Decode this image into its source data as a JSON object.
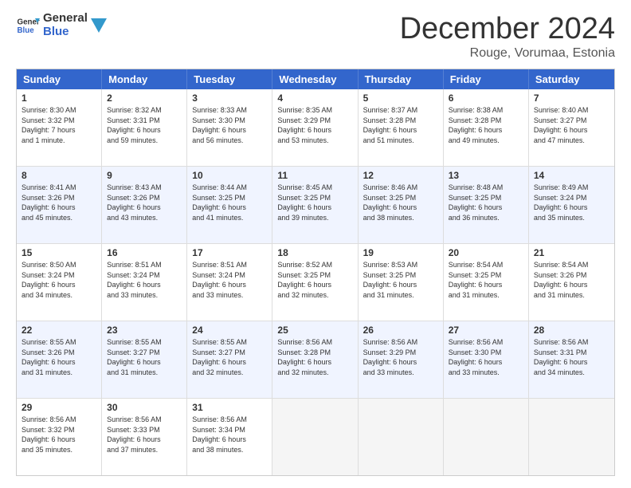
{
  "logo": {
    "line1": "General",
    "line2": "Blue"
  },
  "title": "December 2024",
  "location": "Rouge, Vorumaa, Estonia",
  "days": [
    "Sunday",
    "Monday",
    "Tuesday",
    "Wednesday",
    "Thursday",
    "Friday",
    "Saturday"
  ],
  "weeks": [
    [
      {
        "num": "1",
        "info": "Sunrise: 8:30 AM\nSunset: 3:32 PM\nDaylight: 7 hours\nand 1 minute."
      },
      {
        "num": "2",
        "info": "Sunrise: 8:32 AM\nSunset: 3:31 PM\nDaylight: 6 hours\nand 59 minutes."
      },
      {
        "num": "3",
        "info": "Sunrise: 8:33 AM\nSunset: 3:30 PM\nDaylight: 6 hours\nand 56 minutes."
      },
      {
        "num": "4",
        "info": "Sunrise: 8:35 AM\nSunset: 3:29 PM\nDaylight: 6 hours\nand 53 minutes."
      },
      {
        "num": "5",
        "info": "Sunrise: 8:37 AM\nSunset: 3:28 PM\nDaylight: 6 hours\nand 51 minutes."
      },
      {
        "num": "6",
        "info": "Sunrise: 8:38 AM\nSunset: 3:28 PM\nDaylight: 6 hours\nand 49 minutes."
      },
      {
        "num": "7",
        "info": "Sunrise: 8:40 AM\nSunset: 3:27 PM\nDaylight: 6 hours\nand 47 minutes."
      }
    ],
    [
      {
        "num": "8",
        "info": "Sunrise: 8:41 AM\nSunset: 3:26 PM\nDaylight: 6 hours\nand 45 minutes."
      },
      {
        "num": "9",
        "info": "Sunrise: 8:43 AM\nSunset: 3:26 PM\nDaylight: 6 hours\nand 43 minutes."
      },
      {
        "num": "10",
        "info": "Sunrise: 8:44 AM\nSunset: 3:25 PM\nDaylight: 6 hours\nand 41 minutes."
      },
      {
        "num": "11",
        "info": "Sunrise: 8:45 AM\nSunset: 3:25 PM\nDaylight: 6 hours\nand 39 minutes."
      },
      {
        "num": "12",
        "info": "Sunrise: 8:46 AM\nSunset: 3:25 PM\nDaylight: 6 hours\nand 38 minutes."
      },
      {
        "num": "13",
        "info": "Sunrise: 8:48 AM\nSunset: 3:25 PM\nDaylight: 6 hours\nand 36 minutes."
      },
      {
        "num": "14",
        "info": "Sunrise: 8:49 AM\nSunset: 3:24 PM\nDaylight: 6 hours\nand 35 minutes."
      }
    ],
    [
      {
        "num": "15",
        "info": "Sunrise: 8:50 AM\nSunset: 3:24 PM\nDaylight: 6 hours\nand 34 minutes."
      },
      {
        "num": "16",
        "info": "Sunrise: 8:51 AM\nSunset: 3:24 PM\nDaylight: 6 hours\nand 33 minutes."
      },
      {
        "num": "17",
        "info": "Sunrise: 8:51 AM\nSunset: 3:24 PM\nDaylight: 6 hours\nand 33 minutes."
      },
      {
        "num": "18",
        "info": "Sunrise: 8:52 AM\nSunset: 3:25 PM\nDaylight: 6 hours\nand 32 minutes."
      },
      {
        "num": "19",
        "info": "Sunrise: 8:53 AM\nSunset: 3:25 PM\nDaylight: 6 hours\nand 31 minutes."
      },
      {
        "num": "20",
        "info": "Sunrise: 8:54 AM\nSunset: 3:25 PM\nDaylight: 6 hours\nand 31 minutes."
      },
      {
        "num": "21",
        "info": "Sunrise: 8:54 AM\nSunset: 3:26 PM\nDaylight: 6 hours\nand 31 minutes."
      }
    ],
    [
      {
        "num": "22",
        "info": "Sunrise: 8:55 AM\nSunset: 3:26 PM\nDaylight: 6 hours\nand 31 minutes."
      },
      {
        "num": "23",
        "info": "Sunrise: 8:55 AM\nSunset: 3:27 PM\nDaylight: 6 hours\nand 31 minutes."
      },
      {
        "num": "24",
        "info": "Sunrise: 8:55 AM\nSunset: 3:27 PM\nDaylight: 6 hours\nand 32 minutes."
      },
      {
        "num": "25",
        "info": "Sunrise: 8:56 AM\nSunset: 3:28 PM\nDaylight: 6 hours\nand 32 minutes."
      },
      {
        "num": "26",
        "info": "Sunrise: 8:56 AM\nSunset: 3:29 PM\nDaylight: 6 hours\nand 33 minutes."
      },
      {
        "num": "27",
        "info": "Sunrise: 8:56 AM\nSunset: 3:30 PM\nDaylight: 6 hours\nand 33 minutes."
      },
      {
        "num": "28",
        "info": "Sunrise: 8:56 AM\nSunset: 3:31 PM\nDaylight: 6 hours\nand 34 minutes."
      }
    ],
    [
      {
        "num": "29",
        "info": "Sunrise: 8:56 AM\nSunset: 3:32 PM\nDaylight: 6 hours\nand 35 minutes."
      },
      {
        "num": "30",
        "info": "Sunrise: 8:56 AM\nSunset: 3:33 PM\nDaylight: 6 hours\nand 37 minutes."
      },
      {
        "num": "31",
        "info": "Sunrise: 8:56 AM\nSunset: 3:34 PM\nDaylight: 6 hours\nand 38 minutes."
      },
      {
        "num": "",
        "info": ""
      },
      {
        "num": "",
        "info": ""
      },
      {
        "num": "",
        "info": ""
      },
      {
        "num": "",
        "info": ""
      }
    ]
  ]
}
